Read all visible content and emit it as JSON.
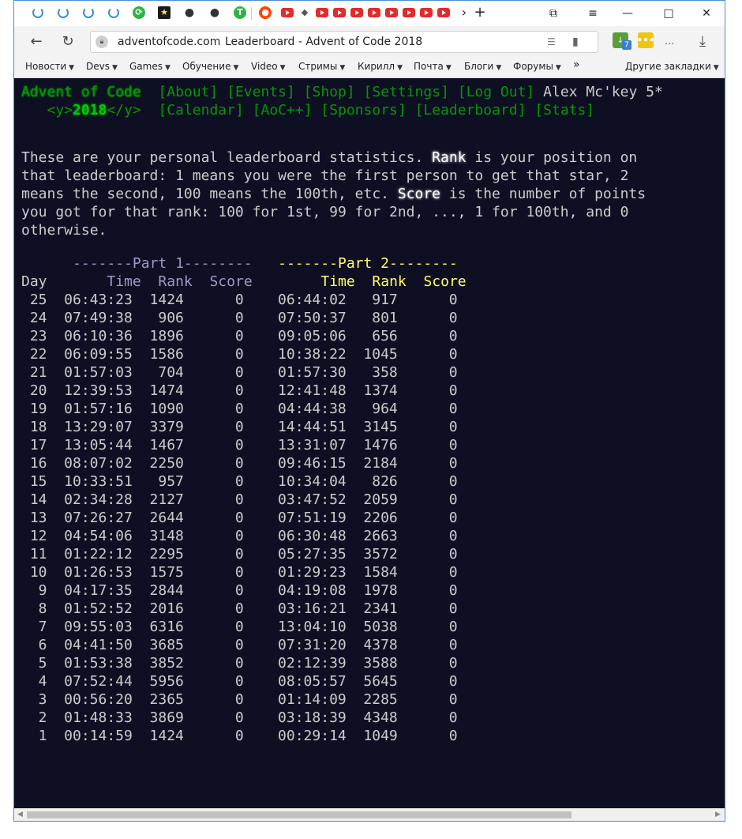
{
  "browser": {
    "tabs": [
      "1",
      "2",
      "3",
      "4",
      "5",
      "6",
      "7",
      "8",
      "9",
      "10",
      "11",
      "12",
      "13",
      "14",
      "15",
      "16",
      "17",
      "18"
    ],
    "address": {
      "domain": "adventofcode.com",
      "page_title": "Leaderboard - Advent of Code 2018"
    },
    "extensions": {
      "badge": "7",
      "more_dots": "..."
    },
    "bookmarks": [
      "Новости",
      "Devs",
      "Games",
      "Обучение",
      "Video",
      "Стримы",
      "Кирилл",
      "Почта",
      "Блоги",
      "Форумы"
    ],
    "bookmarks_more": "»",
    "other_bookmarks": "Другие закладки"
  },
  "site": {
    "brand": "Advent of Code",
    "year_prefix": "<y>",
    "year": "2018",
    "year_suffix": "</y>",
    "nav_row1": [
      "[About]",
      "[Events]",
      "[Shop]",
      "[Settings]",
      "[Log Out]"
    ],
    "nav_row2": [
      "[Calendar]",
      "[AoC++]",
      "[Sponsors]",
      "[Leaderboard]",
      "[Stats]"
    ],
    "user": "Alex Mc'key 5*"
  },
  "intro": {
    "t1": "These are your personal leaderboard statistics. ",
    "rank_word": "Rank",
    "t2": " is your position on\nthat leaderboard: 1 means you were the first person to get that star, 2\nmeans the second, 100 means the 100th, etc. ",
    "score_word": "Score",
    "t3": " is the number of points\nyou got for that rank: 100 for 1st, 99 for 2nd, ..., 1 for 100th, and 0\notherwise."
  },
  "table": {
    "part1_header": "-------Part 1--------",
    "part2_header": "-------Part 2--------",
    "col_day": "Day",
    "col_time": "Time",
    "col_rank": "Rank",
    "col_score": "Score",
    "rows": [
      {
        "day": "25",
        "t1": "06:43:23",
        "r1": "1424",
        "s1": "0",
        "t2": "06:44:02",
        "r2": "917",
        "s2": "0"
      },
      {
        "day": "24",
        "t1": "07:49:38",
        "r1": "906",
        "s1": "0",
        "t2": "07:50:37",
        "r2": "801",
        "s2": "0"
      },
      {
        "day": "23",
        "t1": "06:10:36",
        "r1": "1896",
        "s1": "0",
        "t2": "09:05:06",
        "r2": "656",
        "s2": "0"
      },
      {
        "day": "22",
        "t1": "06:09:55",
        "r1": "1586",
        "s1": "0",
        "t2": "10:38:22",
        "r2": "1045",
        "s2": "0"
      },
      {
        "day": "21",
        "t1": "01:57:03",
        "r1": "704",
        "s1": "0",
        "t2": "01:57:30",
        "r2": "358",
        "s2": "0"
      },
      {
        "day": "20",
        "t1": "12:39:53",
        "r1": "1474",
        "s1": "0",
        "t2": "12:41:48",
        "r2": "1374",
        "s2": "0"
      },
      {
        "day": "19",
        "t1": "01:57:16",
        "r1": "1090",
        "s1": "0",
        "t2": "04:44:38",
        "r2": "964",
        "s2": "0"
      },
      {
        "day": "18",
        "t1": "13:29:07",
        "r1": "3379",
        "s1": "0",
        "t2": "14:44:51",
        "r2": "3145",
        "s2": "0"
      },
      {
        "day": "17",
        "t1": "13:05:44",
        "r1": "1467",
        "s1": "0",
        "t2": "13:31:07",
        "r2": "1476",
        "s2": "0"
      },
      {
        "day": "16",
        "t1": "08:07:02",
        "r1": "2250",
        "s1": "0",
        "t2": "09:46:15",
        "r2": "2184",
        "s2": "0"
      },
      {
        "day": "15",
        "t1": "10:33:51",
        "r1": "957",
        "s1": "0",
        "t2": "10:34:04",
        "r2": "826",
        "s2": "0"
      },
      {
        "day": "14",
        "t1": "02:34:28",
        "r1": "2127",
        "s1": "0",
        "t2": "03:47:52",
        "r2": "2059",
        "s2": "0"
      },
      {
        "day": "13",
        "t1": "07:26:27",
        "r1": "2644",
        "s1": "0",
        "t2": "07:51:19",
        "r2": "2206",
        "s2": "0"
      },
      {
        "day": "12",
        "t1": "04:54:06",
        "r1": "3148",
        "s1": "0",
        "t2": "06:30:48",
        "r2": "2663",
        "s2": "0"
      },
      {
        "day": "11",
        "t1": "01:22:12",
        "r1": "2295",
        "s1": "0",
        "t2": "05:27:35",
        "r2": "3572",
        "s2": "0"
      },
      {
        "day": "10",
        "t1": "01:26:53",
        "r1": "1575",
        "s1": "0",
        "t2": "01:29:23",
        "r2": "1584",
        "s2": "0"
      },
      {
        "day": "9",
        "t1": "04:17:35",
        "r1": "2844",
        "s1": "0",
        "t2": "04:19:08",
        "r2": "1978",
        "s2": "0"
      },
      {
        "day": "8",
        "t1": "01:52:52",
        "r1": "2016",
        "s1": "0",
        "t2": "03:16:21",
        "r2": "2341",
        "s2": "0"
      },
      {
        "day": "7",
        "t1": "09:55:03",
        "r1": "6316",
        "s1": "0",
        "t2": "13:04:10",
        "r2": "5038",
        "s2": "0"
      },
      {
        "day": "6",
        "t1": "04:41:50",
        "r1": "3685",
        "s1": "0",
        "t2": "07:31:20",
        "r2": "4378",
        "s2": "0"
      },
      {
        "day": "5",
        "t1": "01:53:38",
        "r1": "3852",
        "s1": "0",
        "t2": "02:12:39",
        "r2": "3588",
        "s2": "0"
      },
      {
        "day": "4",
        "t1": "07:52:44",
        "r1": "5956",
        "s1": "0",
        "t2": "08:05:57",
        "r2": "5645",
        "s2": "0"
      },
      {
        "day": "3",
        "t1": "00:56:20",
        "r1": "2365",
        "s1": "0",
        "t2": "01:14:09",
        "r2": "2285",
        "s2": "0"
      },
      {
        "day": "2",
        "t1": "01:48:33",
        "r1": "3869",
        "s1": "0",
        "t2": "03:18:39",
        "r2": "4348",
        "s2": "0"
      },
      {
        "day": "1",
        "t1": "00:14:59",
        "r1": "1424",
        "s1": "0",
        "t2": "00:29:14",
        "r2": "1049",
        "s2": "0"
      }
    ]
  }
}
